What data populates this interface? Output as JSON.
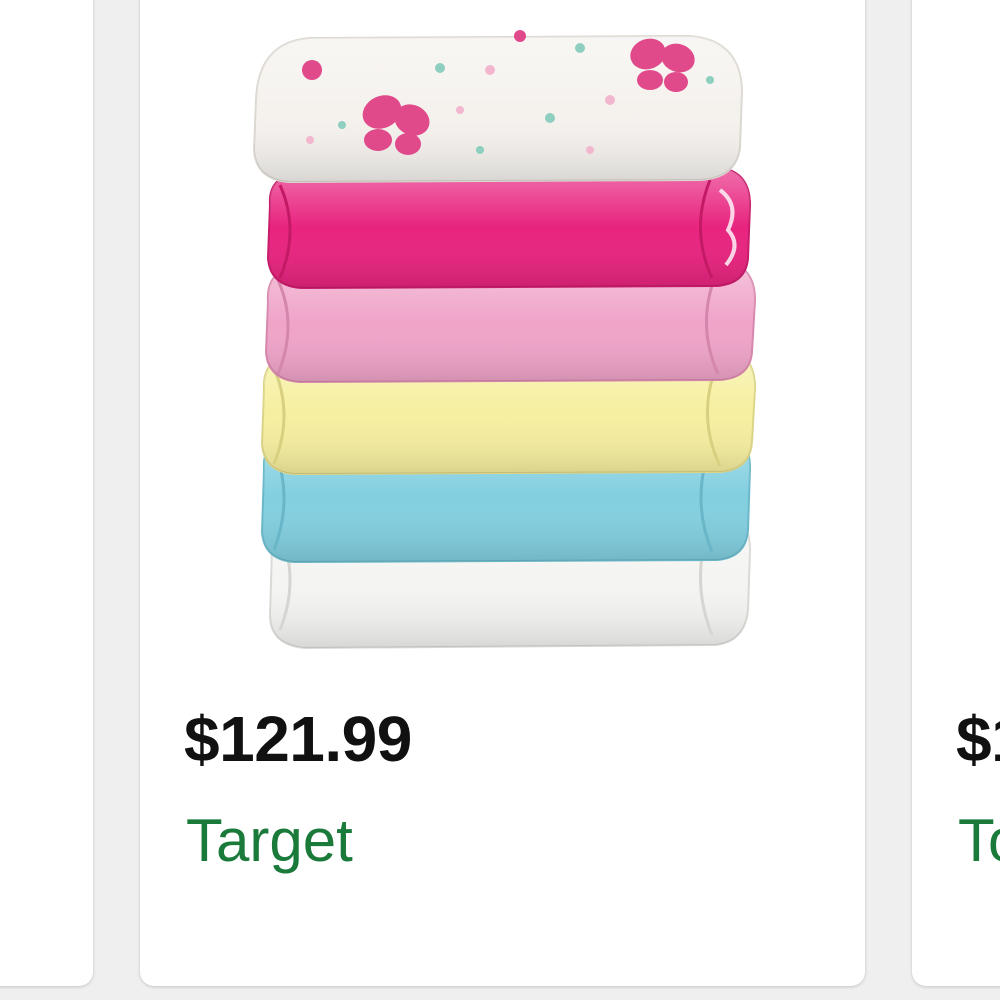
{
  "cards": [
    {
      "id": "left",
      "price": "",
      "store": ""
    },
    {
      "id": "main",
      "price": "$121.99",
      "store": "Target",
      "image": "stack-of-cloth-diapers"
    },
    {
      "id": "right",
      "price": "$1",
      "store": "To"
    }
  ],
  "colors": {
    "page_bg": "#efefef",
    "card_bg": "#ffffff",
    "price_text": "#111111",
    "store_text": "#1a7a3a",
    "diaper_print_bg": "#f5f2ee",
    "diaper_hot_pink": "#e8237f",
    "diaper_light_pink": "#efa4c8",
    "diaper_yellow": "#f6ef9f",
    "diaper_blue": "#82cfe0",
    "diaper_white": "#f4f4f2"
  }
}
